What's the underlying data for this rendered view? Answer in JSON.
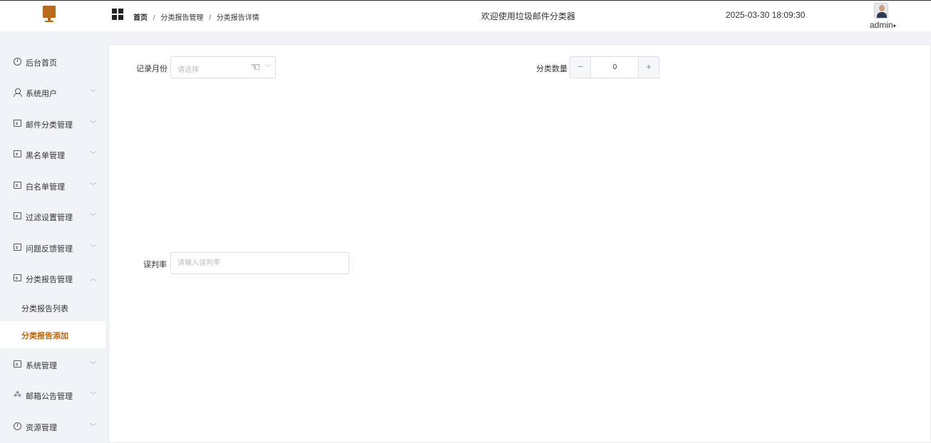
{
  "header": {
    "logo_icon": "computer-monitor-icon",
    "menu_icon": "grid-icon",
    "breadcrumb": [
      "首页",
      "分类报告管理",
      "分类报告详情"
    ],
    "breadcrumb_separator": "/",
    "welcome": "欢迎使用垃圾邮件分类器",
    "datetime": "2025-03-30 18:09:30",
    "user": "admin",
    "user_dropdown_icon": "caret-down-icon"
  },
  "sidebar": {
    "items": [
      {
        "label": "后台首页",
        "icon": "clock-icon",
        "expandable": false
      },
      {
        "label": "系统用户",
        "icon": "user-icon",
        "expandable": true
      },
      {
        "label": "邮件分类管理",
        "icon": "list-box-icon",
        "expandable": true
      },
      {
        "label": "黑名单管理",
        "icon": "list-box-icon",
        "expandable": true
      },
      {
        "label": "白名单管理",
        "icon": "list-box-icon",
        "expandable": true
      },
      {
        "label": "过滤设置管理",
        "icon": "list-box-icon",
        "expandable": true
      },
      {
        "label": "问题反馈管理",
        "icon": "list-box-icon",
        "expandable": true
      },
      {
        "label": "分类报告管理",
        "icon": "list-box-icon",
        "expandable": true,
        "expanded": true
      },
      {
        "label": "系统管理",
        "icon": "folder-icon",
        "expandable": true
      },
      {
        "label": "邮箱公告管理",
        "icon": "sparkle-icon",
        "expandable": true
      },
      {
        "label": "资源管理",
        "icon": "database-icon",
        "expandable": true
      }
    ],
    "subitems": [
      {
        "label": "分类报告列表",
        "active": false
      },
      {
        "label": "分类报告添加",
        "active": true
      }
    ],
    "arrow_down": "﹀",
    "arrow_up": "︿"
  },
  "form": {
    "month_label": "记录月份",
    "month_placeholder": "请选择",
    "count_label": "分类数量",
    "count_value": "0",
    "minus": "−",
    "plus": "+",
    "error_rate_label": "误判率",
    "error_rate_placeholder": "请输入误判率"
  },
  "colors": {
    "accent": "#b8630e",
    "sidebar_bg": "#f0f4f8",
    "logo": "#b86a1a"
  }
}
